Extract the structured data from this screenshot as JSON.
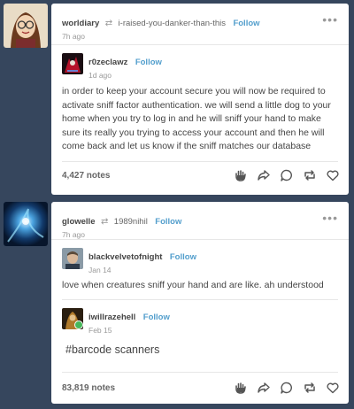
{
  "posts": [
    {
      "poster": "worldiary",
      "reblogged_from": "i-raised-you-danker-than-this",
      "follow_label": "Follow",
      "time": "7h ago",
      "menu": "•••",
      "trail_user": "r0zeclawz",
      "trail_follow_label": "Follow",
      "trail_time": "1d ago",
      "body": "in order to keep your account secure you will now be required to activate sniff factor authentication. we will send a little dog to your home when you try to log in and he will sniff your hand to make sure its really you trying to access your account and then he will come back and let us know if the sniff matches our database",
      "notes": "4,427 notes",
      "icons": [
        "hand-icon",
        "share-icon",
        "reply-icon",
        "reblog-icon",
        "heart-icon"
      ]
    },
    {
      "poster": "glowelle",
      "reblogged_from": "1989nihil",
      "follow_label": "Follow",
      "time": "7h ago",
      "menu": "•••",
      "trail_user": "blackvelvetofnight",
      "trail_follow_label": "Follow",
      "trail_time": "Jan 14",
      "body": "love when creatures sniff your hand and are like. ah understood",
      "trail2_user": "iwillrazehell",
      "trail2_follow_label": "Follow",
      "trail2_time": "Feb 15",
      "tag": "#barcode scanners",
      "notes": "83,819 notes",
      "icons": [
        "hand-icon",
        "share-icon",
        "reply-icon",
        "reblog-icon",
        "heart-icon"
      ]
    }
  ],
  "colors": {
    "background": "#36465d",
    "card": "#ffffff",
    "follow": "#529ecc"
  }
}
